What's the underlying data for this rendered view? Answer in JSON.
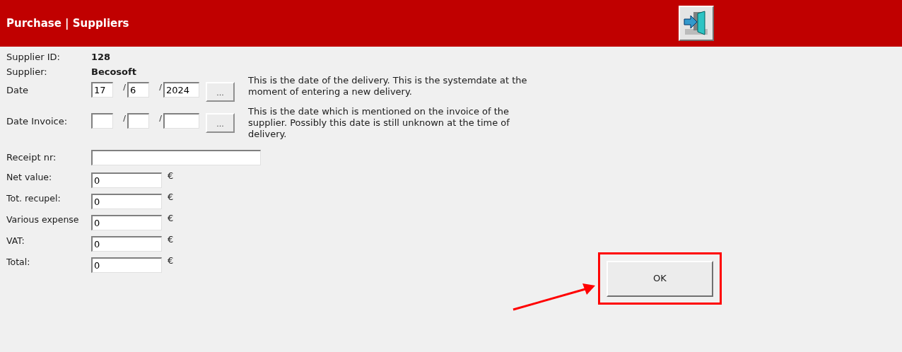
{
  "header": {
    "title": "Purchase | Suppliers"
  },
  "supplier": [
    {
      "label": "Supplier ID:",
      "value": "128"
    },
    {
      "label": "Supplier:",
      "value": "Becosoft"
    }
  ],
  "dates": [
    {
      "label": "Date",
      "day": "17",
      "month": "6",
      "year": "2024",
      "separator": "/",
      "picker": "...",
      "help": "This is the date of the delivery. This is the systemdate at the moment of entering a new delivery."
    },
    {
      "label": "Date Invoice:",
      "separator": "/",
      "picker": "...",
      "help": "This is the date which is mentioned on the invoice of the supplier. Possibly this date is still unknown at the time of delivery."
    }
  ],
  "receipt": {
    "label": "Receipt nr:"
  },
  "amounts": [
    {
      "label": "Net value:",
      "value": "0",
      "currency": "€"
    },
    {
      "label": "Tot. recupel:",
      "value": "0",
      "currency": "€"
    },
    {
      "label": "Various expense",
      "value": "0",
      "currency": "€"
    },
    {
      "label": "VAT:",
      "value": "0",
      "currency": "€"
    },
    {
      "label": "Total:",
      "value": "0",
      "currency": "€"
    }
  ],
  "ok_button": {
    "label": "OK",
    "highlighted": true
  }
}
